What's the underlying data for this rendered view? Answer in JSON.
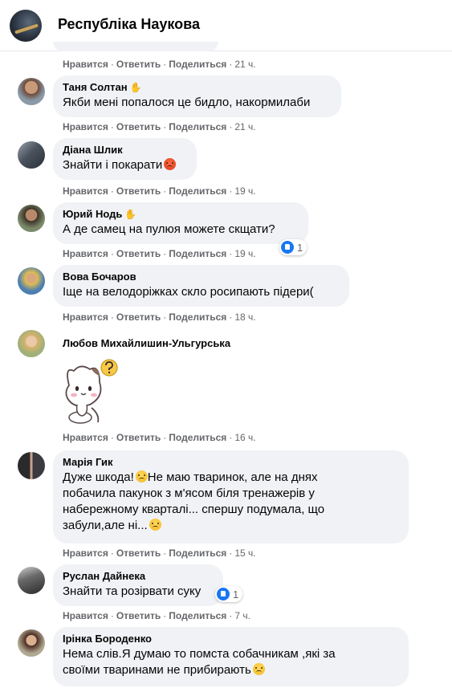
{
  "header": {
    "page_name": "Республіка Наукова"
  },
  "actions": {
    "like": "Нравится",
    "reply": "Ответить",
    "share": "Поделиться",
    "sep": "·"
  },
  "top_action_row": {
    "time": "21 ч."
  },
  "comments": [
    {
      "author": "Таня Солтан",
      "text": "Якби мені попалося це бидло, накормилаби",
      "time": "21 ч."
    },
    {
      "author": "Діана Шлик",
      "text": "Знайти і покарати",
      "time": "19 ч."
    },
    {
      "author": "Юрий Нодь",
      "text": "А де самец на пулюя можете скщати?",
      "time": "19 ч.",
      "reactions": "1"
    },
    {
      "author": "Вова Бочаров",
      "text": "Іще на велодоріжках скло росипають підери(",
      "time": "18 ч."
    },
    {
      "author": "Любов Михайлишин-Ульгурська",
      "text": "",
      "time": "16 ч."
    },
    {
      "author": "Марія Гик",
      "text_lines": [
        "Дуже шкода!",
        "Не маю тваринок, але на днях",
        "побачила пакунок з м'ясом біля тренажерів у",
        "набережному кварталі... спершу подумала, що",
        "забули,але ні..."
      ],
      "time": "15 ч."
    },
    {
      "author": "Руслан Дайнека",
      "text": "Знайти та розірвати суку",
      "time": "7 ч.",
      "reactions": "1"
    },
    {
      "author": "Ірінка Бороденко",
      "text_lines": [
        "Нема слів.Я думаю то помста собачникам ,які за",
        "своїми тваринами не прибирають"
      ],
      "time": ""
    }
  ],
  "colors": {
    "bubble": "#f0f2f5",
    "meta": "#65676b",
    "like_blue": "#1877f2"
  }
}
